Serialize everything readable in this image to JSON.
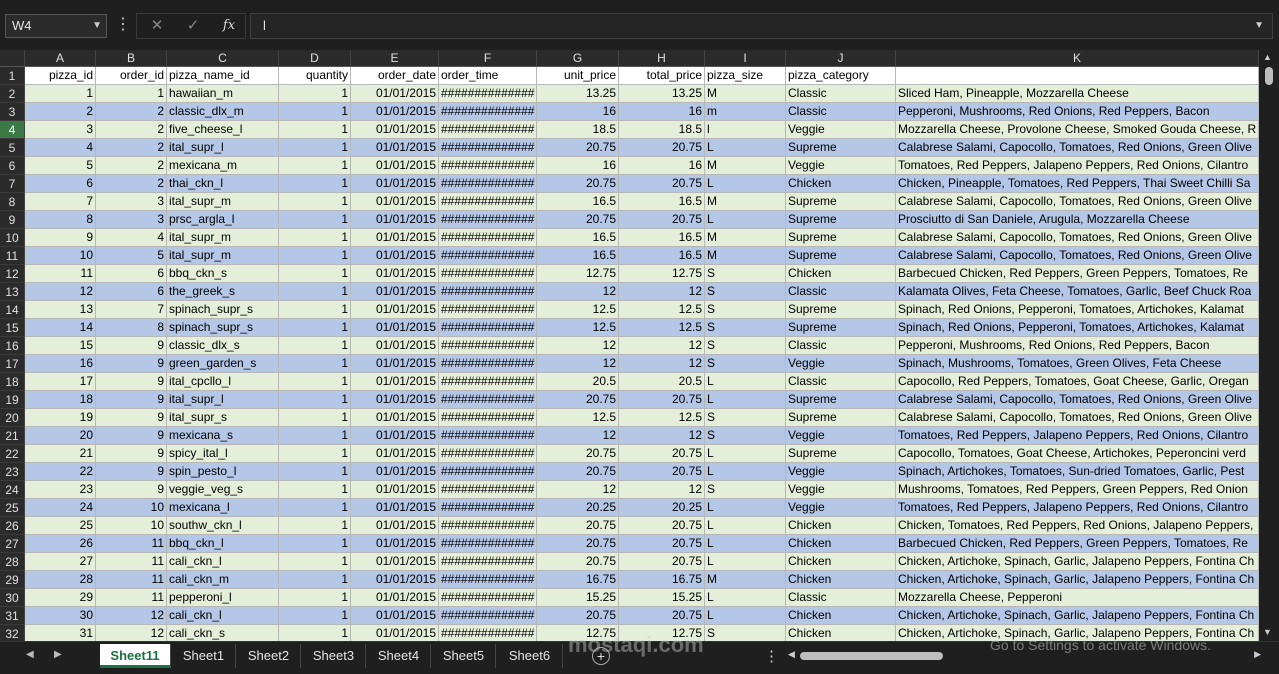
{
  "formula_bar": {
    "name_box": "W4",
    "cancel_glyph": "✕",
    "enter_glyph": "✓",
    "fx_label": "fx",
    "content": "l"
  },
  "columns": [
    "A",
    "B",
    "C",
    "D",
    "E",
    "F",
    "G",
    "H",
    "I",
    "J",
    "K"
  ],
  "headers": [
    "pizza_id",
    "order_id",
    "pizza_name_id",
    "quantity",
    "order_date",
    "order_time",
    "unit_price",
    "total_price",
    "pizza_size",
    "pizza_category",
    ""
  ],
  "rows": [
    {
      "n": "2",
      "c": [
        "1",
        "1",
        "hawaiian_m",
        "1",
        "01/01/2015",
        "##############",
        "13.25",
        "13.25",
        "M",
        "Classic",
        "Sliced Ham, Pineapple, Mozzarella Cheese"
      ]
    },
    {
      "n": "3",
      "c": [
        "2",
        "2",
        "classic_dlx_m",
        "1",
        "01/01/2015",
        "##############",
        "16",
        "16",
        "m",
        "Classic",
        "Pepperoni, Mushrooms, Red Onions, Red Peppers, Bacon"
      ]
    },
    {
      "n": "4",
      "c": [
        "3",
        "2",
        "five_cheese_l",
        "1",
        "01/01/2015",
        "##############",
        "18.5",
        "18.5",
        "l",
        "Veggie",
        "Mozzarella Cheese, Provolone Cheese, Smoked Gouda Cheese, R"
      ]
    },
    {
      "n": "5",
      "c": [
        "4",
        "2",
        "ital_supr_l",
        "1",
        "01/01/2015",
        "##############",
        "20.75",
        "20.75",
        "L",
        "Supreme",
        "Calabrese Salami, Capocollo, Tomatoes, Red Onions, Green Olive"
      ]
    },
    {
      "n": "6",
      "c": [
        "5",
        "2",
        "mexicana_m",
        "1",
        "01/01/2015",
        "##############",
        "16",
        "16",
        "M",
        "Veggie",
        "Tomatoes, Red Peppers, Jalapeno Peppers, Red Onions, Cilantro"
      ]
    },
    {
      "n": "7",
      "c": [
        "6",
        "2",
        "thai_ckn_l",
        "1",
        "01/01/2015",
        "##############",
        "20.75",
        "20.75",
        "L",
        "Chicken",
        "Chicken, Pineapple, Tomatoes, Red Peppers, Thai Sweet Chilli Sa"
      ]
    },
    {
      "n": "8",
      "c": [
        "7",
        "3",
        "ital_supr_m",
        "1",
        "01/01/2015",
        "##############",
        "16.5",
        "16.5",
        "M",
        "Supreme",
        "Calabrese Salami, Capocollo, Tomatoes, Red Onions, Green Olive"
      ]
    },
    {
      "n": "9",
      "c": [
        "8",
        "3",
        "prsc_argla_l",
        "1",
        "01/01/2015",
        "##############",
        "20.75",
        "20.75",
        "L",
        "Supreme",
        "Prosciutto di San Daniele, Arugula, Mozzarella Cheese"
      ]
    },
    {
      "n": "10",
      "c": [
        "9",
        "4",
        "ital_supr_m",
        "1",
        "01/01/2015",
        "##############",
        "16.5",
        "16.5",
        "M",
        "Supreme",
        "Calabrese Salami, Capocollo, Tomatoes, Red Onions, Green Olive"
      ]
    },
    {
      "n": "11",
      "c": [
        "10",
        "5",
        "ital_supr_m",
        "1",
        "01/01/2015",
        "##############",
        "16.5",
        "16.5",
        "M",
        "Supreme",
        "Calabrese Salami, Capocollo, Tomatoes, Red Onions, Green Olive"
      ]
    },
    {
      "n": "12",
      "c": [
        "11",
        "6",
        "bbq_ckn_s",
        "1",
        "01/01/2015",
        "##############",
        "12.75",
        "12.75",
        "S",
        "Chicken",
        "Barbecued Chicken, Red Peppers, Green Peppers, Tomatoes, Re"
      ]
    },
    {
      "n": "13",
      "c": [
        "12",
        "6",
        "the_greek_s",
        "1",
        "01/01/2015",
        "##############",
        "12",
        "12",
        "S",
        "Classic",
        "Kalamata Olives, Feta Cheese, Tomatoes, Garlic, Beef Chuck Roa"
      ]
    },
    {
      "n": "14",
      "c": [
        "13",
        "7",
        "spinach_supr_s",
        "1",
        "01/01/2015",
        "##############",
        "12.5",
        "12.5",
        "S",
        "Supreme",
        "Spinach, Red Onions, Pepperoni, Tomatoes, Artichokes, Kalamat"
      ]
    },
    {
      "n": "15",
      "c": [
        "14",
        "8",
        "spinach_supr_s",
        "1",
        "01/01/2015",
        "##############",
        "12.5",
        "12.5",
        "S",
        "Supreme",
        "Spinach, Red Onions, Pepperoni, Tomatoes, Artichokes, Kalamat"
      ]
    },
    {
      "n": "16",
      "c": [
        "15",
        "9",
        "classic_dlx_s",
        "1",
        "01/01/2015",
        "##############",
        "12",
        "12",
        "S",
        "Classic",
        "Pepperoni, Mushrooms, Red Onions, Red Peppers, Bacon"
      ]
    },
    {
      "n": "17",
      "c": [
        "16",
        "9",
        "green_garden_s",
        "1",
        "01/01/2015",
        "##############",
        "12",
        "12",
        "S",
        "Veggie",
        "Spinach, Mushrooms, Tomatoes, Green Olives, Feta Cheese"
      ]
    },
    {
      "n": "18",
      "c": [
        "17",
        "9",
        "ital_cpcllo_l",
        "1",
        "01/01/2015",
        "##############",
        "20.5",
        "20.5",
        "L",
        "Classic",
        "Capocollo, Red Peppers, Tomatoes, Goat Cheese, Garlic, Oregan"
      ]
    },
    {
      "n": "19",
      "c": [
        "18",
        "9",
        "ital_supr_l",
        "1",
        "01/01/2015",
        "##############",
        "20.75",
        "20.75",
        "L",
        "Supreme",
        "Calabrese Salami, Capocollo, Tomatoes, Red Onions, Green Olive"
      ]
    },
    {
      "n": "20",
      "c": [
        "19",
        "9",
        "ital_supr_s",
        "1",
        "01/01/2015",
        "##############",
        "12.5",
        "12.5",
        "S",
        "Supreme",
        "Calabrese Salami, Capocollo, Tomatoes, Red Onions, Green Olive"
      ]
    },
    {
      "n": "21",
      "c": [
        "20",
        "9",
        "mexicana_s",
        "1",
        "01/01/2015",
        "##############",
        "12",
        "12",
        "S",
        "Veggie",
        "Tomatoes, Red Peppers, Jalapeno Peppers, Red Onions, Cilantro"
      ]
    },
    {
      "n": "22",
      "c": [
        "21",
        "9",
        "spicy_ital_l",
        "1",
        "01/01/2015",
        "##############",
        "20.75",
        "20.75",
        "L",
        "Supreme",
        "Capocollo, Tomatoes, Goat Cheese, Artichokes, Peperoncini verd"
      ]
    },
    {
      "n": "23",
      "c": [
        "22",
        "9",
        "spin_pesto_l",
        "1",
        "01/01/2015",
        "##############",
        "20.75",
        "20.75",
        "L",
        "Veggie",
        "Spinach, Artichokes, Tomatoes, Sun-dried Tomatoes, Garlic, Pest"
      ]
    },
    {
      "n": "24",
      "c": [
        "23",
        "9",
        "veggie_veg_s",
        "1",
        "01/01/2015",
        "##############",
        "12",
        "12",
        "S",
        "Veggie",
        "Mushrooms, Tomatoes, Red Peppers, Green Peppers, Red Onion"
      ]
    },
    {
      "n": "25",
      "c": [
        "24",
        "10",
        "mexicana_l",
        "1",
        "01/01/2015",
        "##############",
        "20.25",
        "20.25",
        "L",
        "Veggie",
        "Tomatoes, Red Peppers, Jalapeno Peppers, Red Onions, Cilantro"
      ]
    },
    {
      "n": "26",
      "c": [
        "25",
        "10",
        "southw_ckn_l",
        "1",
        "01/01/2015",
        "##############",
        "20.75",
        "20.75",
        "L",
        "Chicken",
        "Chicken, Tomatoes, Red Peppers, Red Onions, Jalapeno Peppers,"
      ]
    },
    {
      "n": "27",
      "c": [
        "26",
        "11",
        "bbq_ckn_l",
        "1",
        "01/01/2015",
        "##############",
        "20.75",
        "20.75",
        "L",
        "Chicken",
        "Barbecued Chicken, Red Peppers, Green Peppers, Tomatoes, Re"
      ]
    },
    {
      "n": "28",
      "c": [
        "27",
        "11",
        "cali_ckn_l",
        "1",
        "01/01/2015",
        "##############",
        "20.75",
        "20.75",
        "L",
        "Chicken",
        "Chicken, Artichoke, Spinach, Garlic, Jalapeno Peppers, Fontina Ch"
      ]
    },
    {
      "n": "29",
      "c": [
        "28",
        "11",
        "cali_ckn_m",
        "1",
        "01/01/2015",
        "##############",
        "16.75",
        "16.75",
        "M",
        "Chicken",
        "Chicken, Artichoke, Spinach, Garlic, Jalapeno Peppers, Fontina Ch"
      ]
    },
    {
      "n": "30",
      "c": [
        "29",
        "11",
        "pepperoni_l",
        "1",
        "01/01/2015",
        "##############",
        "15.25",
        "15.25",
        "L",
        "Classic",
        "Mozzarella Cheese, Pepperoni"
      ]
    },
    {
      "n": "31",
      "c": [
        "30",
        "12",
        "cali_ckn_l",
        "1",
        "01/01/2015",
        "##############",
        "20.75",
        "20.75",
        "L",
        "Chicken",
        "Chicken, Artichoke, Spinach, Garlic, Jalapeno Peppers, Fontina Ch"
      ]
    },
    {
      "n": "32",
      "c": [
        "31",
        "12",
        "cali_ckn_s",
        "1",
        "01/01/2015",
        "##############",
        "12.75",
        "12.75",
        "S",
        "Chicken",
        "Chicken, Artichoke, Spinach, Garlic, Jalapeno Peppers, Fontina Ch"
      ]
    }
  ],
  "sheets": [
    "Sheet11",
    "Sheet1",
    "Sheet2",
    "Sheet3",
    "Sheet4",
    "Sheet5",
    "Sheet6"
  ],
  "active_sheet": "Sheet11",
  "selected_row": "4",
  "colors": {
    "green_row": "#e4eed9",
    "blue_row": "#b4c7e7",
    "accent": "#1e7145"
  },
  "watermark": "mostaqi.com",
  "activate_notice": "Go to Settings to activate Windows."
}
